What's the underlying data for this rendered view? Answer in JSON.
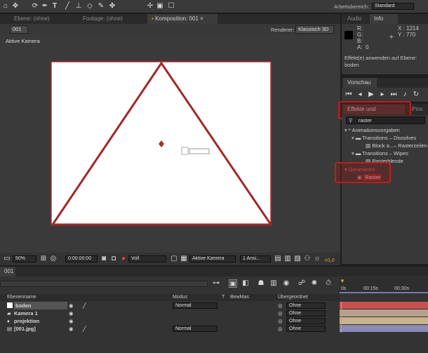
{
  "toolbar": {
    "workspace_label": "Arbeitsbereich:",
    "workspace_value": "Standard"
  },
  "viewer": {
    "tabs": [
      {
        "label": "Ebene: (ohne)"
      },
      {
        "label": "Footage: (ohne)"
      },
      {
        "label": "Komposition: 001"
      }
    ],
    "comp_name": "001",
    "renderer_label": "Renderer:",
    "renderer_value": "Klassisch 3D",
    "camera_label": "Aktive Kamera",
    "footer": {
      "zoom": "50%",
      "timecode": "0:00:00:00",
      "resolution": "Voll",
      "camera": "Aktive Kamera",
      "views": "1 Ansi...",
      "exposure": "+0,0"
    }
  },
  "info": {
    "tabs": [
      {
        "label": "Audio"
      },
      {
        "label": "Info"
      }
    ],
    "r": "R:",
    "g": "G:",
    "b": "B:",
    "a": "A:",
    "a_value": "0",
    "x": "X : 1214",
    "y": "Y : 770",
    "message": "Effekt(e) anwenden auf Ebene: boden"
  },
  "preview": {
    "title": "Vorschau"
  },
  "effects": {
    "tab_label": "Effekte und Vorgaben",
    "tab2_label": "Pins",
    "search_value": "raster",
    "tree": [
      {
        "label": "* Animationsvorgaben"
      },
      {
        "label": "Transitions – Dissolves"
      },
      {
        "label": "Block a...– Rasterzeilen"
      },
      {
        "label": "Transitions – Wipes"
      },
      {
        "label": "Rasterblende"
      },
      {
        "label": "Generieren"
      },
      {
        "label": "Raster"
      }
    ]
  },
  "timeline": {
    "tab_label": "001",
    "columns": {
      "name": "Ebenenname",
      "mode": "Modus",
      "t": "T",
      "trkmat": "BewMas",
      "parent": "Übergeordnet"
    },
    "ruler": {
      "t0": "0s",
      "t1": "00:15s",
      "t2": "00:30s"
    },
    "layers": [
      {
        "name": "boden",
        "mode": "Normal",
        "parent": "Ohne",
        "color": "#c85050"
      },
      {
        "name": "Kamera 1",
        "mode": "",
        "parent": "Ohne",
        "color": "#b8a090"
      },
      {
        "name": "projektion",
        "mode": "",
        "parent": "Ohne",
        "color": "#c8b48c"
      },
      {
        "name": "[001.jpg]",
        "mode": "Normal",
        "parent": "Ohne",
        "color": "#8a8ab4"
      }
    ]
  }
}
